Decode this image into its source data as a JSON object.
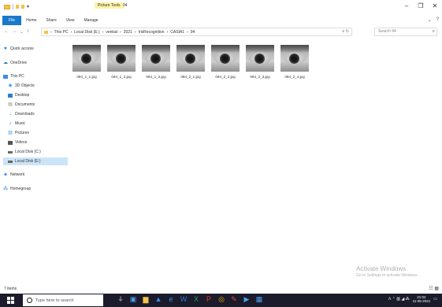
{
  "titlebar": {
    "picture_tools": "Picture Tools",
    "title": "94",
    "minimize": "–",
    "maximize": "❐",
    "close": "✕"
  },
  "ribbon": {
    "tabs": [
      {
        "label": "File"
      },
      {
        "label": "Home"
      },
      {
        "label": "Share"
      },
      {
        "label": "View"
      },
      {
        "label": "Manage"
      }
    ]
  },
  "address": {
    "back": "←",
    "forward": "→",
    "recent": "⌄",
    "up": "↑",
    "path": [
      "This PC",
      "Local Disk (E:)",
      "venkat",
      "2021",
      "IrisRecognition",
      "CASIA1",
      "94"
    ],
    "separator": "›",
    "dropdown": "∨",
    "refresh": "↻",
    "search_placeholder": "Search 94"
  },
  "sidebar": {
    "items": [
      {
        "label": "Quick access",
        "icon": "star-icon",
        "color": "#1e7bd6",
        "glyph": "★"
      },
      {
        "label": "OneDrive",
        "icon": "cloud-icon",
        "color": "#1e7bd6",
        "glyph": "☁"
      },
      {
        "label": "This PC",
        "icon": "computer-icon",
        "color": "#3a8ee6",
        "glyph": "▭"
      },
      {
        "label": "3D Objects",
        "icon": "cube-icon",
        "color": "#4aa3f0",
        "glyph": "◆"
      },
      {
        "label": "Desktop",
        "icon": "desktop-icon",
        "color": "#2a7fd8",
        "glyph": "■"
      },
      {
        "label": "Documents",
        "icon": "document-icon",
        "color": "#8a8a8a",
        "glyph": "▤"
      },
      {
        "label": "Downloads",
        "icon": "download-icon",
        "color": "#2a7fd8",
        "glyph": "↓"
      },
      {
        "label": "Music",
        "icon": "music-icon",
        "color": "#2a7fd8",
        "glyph": "♪"
      },
      {
        "label": "Pictures",
        "icon": "pictures-icon",
        "color": "#4aa3f0",
        "glyph": "▨"
      },
      {
        "label": "Videos",
        "icon": "video-icon",
        "color": "#555555",
        "glyph": "▬"
      },
      {
        "label": "Local Disk (C:)",
        "icon": "drive-icon",
        "color": "#666666",
        "glyph": "▭"
      },
      {
        "label": "Local Disk (E:)",
        "icon": "drive-icon",
        "color": "#666666",
        "glyph": "▭"
      },
      {
        "label": "Network",
        "icon": "network-icon",
        "color": "#2a7fd8",
        "glyph": "◈"
      },
      {
        "label": "Homegroup",
        "icon": "homegroup-icon",
        "color": "#2a7fd8",
        "glyph": "⁂"
      }
    ]
  },
  "files": [
    {
      "name": "094_1_1.jpg"
    },
    {
      "name": "094_1_2.jpg"
    },
    {
      "name": "094_1_3.jpg"
    },
    {
      "name": "094_2_1.jpg"
    },
    {
      "name": "094_2_2.jpg"
    },
    {
      "name": "094_2_3.jpg"
    },
    {
      "name": "094_2_4.jpg"
    }
  ],
  "watermark": {
    "title": "Activate Windows",
    "subtitle": "Go to Settings to activate Windows."
  },
  "status": {
    "count": "7 items",
    "view_icons": "☷ ▦"
  },
  "taskbar": {
    "search_placeholder": "Type here to search",
    "apps": [
      {
        "icon": "microphone-icon",
        "glyph": "🎙"
      },
      {
        "icon": "task-view-icon",
        "glyph": "▣"
      },
      {
        "icon": "file-explorer-icon",
        "glyph": "▆"
      },
      {
        "icon": "store-icon",
        "glyph": "▲"
      },
      {
        "icon": "edge-icon",
        "glyph": "e"
      },
      {
        "icon": "word-icon",
        "glyph": "W"
      },
      {
        "icon": "excel-icon",
        "glyph": "X"
      },
      {
        "icon": "powerpoint-icon",
        "glyph": "P"
      },
      {
        "icon": "chrome-icon",
        "glyph": "◎"
      },
      {
        "icon": "paint-icon",
        "glyph": "✎"
      },
      {
        "icon": "media-icon",
        "glyph": "▶"
      },
      {
        "icon": "photos-icon",
        "glyph": "▦"
      }
    ],
    "tray": {
      "icons": "ᐱ ⌃ ▥ ◢ ⁂",
      "time": "21:04",
      "date": "11-05-2021"
    }
  },
  "colors": {
    "accent": "#1979ca",
    "taskbar": "#1b1b2b",
    "selected": "#cce4f7"
  }
}
